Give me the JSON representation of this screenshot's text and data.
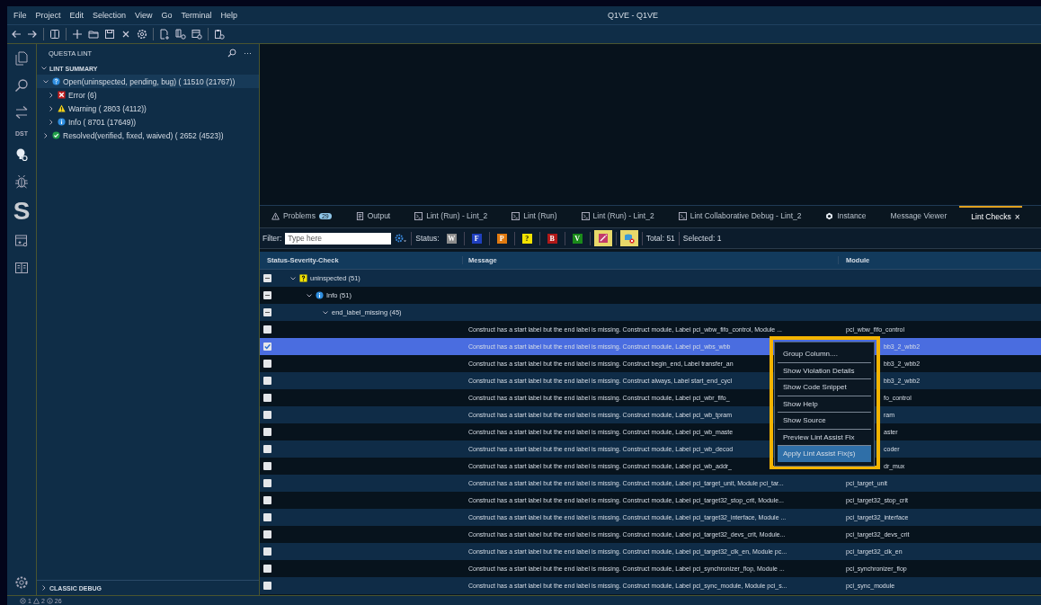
{
  "menu": [
    "File",
    "Project",
    "Edit",
    "Selection",
    "View",
    "Go",
    "Terminal",
    "Help"
  ],
  "window": {
    "title": "Q1VE - Q1VE"
  },
  "activity_bar": {
    "labels": [
      {
        "kind": "dst",
        "text": "DST"
      },
      {
        "kind": "s",
        "text": "S"
      }
    ]
  },
  "sidebar": {
    "title": "QUESTA LINT",
    "more": "···",
    "section": {
      "title": "LINT SUMMARY",
      "expanded": true,
      "items": [
        {
          "label": "Open(uninspected, pending, bug) ( 11510 (21767))",
          "kind": "question",
          "expanded": true,
          "selected": true,
          "children": [
            {
              "label": "Error (6)",
              "kind": "error",
              "expanded": false,
              "selected": false
            },
            {
              "label": "Warning ( 2803 (4112))",
              "kind": "warning",
              "expanded": false,
              "selected": false
            },
            {
              "label": "Info ( 8701 (17649))",
              "kind": "info",
              "expanded": false,
              "selected": false
            }
          ]
        },
        {
          "label": "Resolved(verified, fixed, waived) ( 2652 (4523))",
          "kind": "resolved",
          "expanded": false,
          "selected": false
        }
      ]
    },
    "bottom_section": {
      "title": "CLASSIC DEBUG",
      "expanded": false
    }
  },
  "panel": {
    "tabs": [
      {
        "label": "Problems",
        "kind": "warning",
        "badge": "29",
        "selected": false
      },
      {
        "label": "Output",
        "kind": "output",
        "selected": false
      },
      {
        "label": "Lint (Run) - Lint_2",
        "kind": "terminal",
        "selected": false
      },
      {
        "label": "Lint (Run)",
        "kind": "terminal",
        "selected": false
      },
      {
        "label": "Lint (Run) - Lint_2",
        "kind": "terminal",
        "selected": false
      },
      {
        "label": "Lint Collaborative Debug - Lint_2",
        "kind": "terminal",
        "selected": false
      },
      {
        "label": "Instance",
        "kind": "instance",
        "selected": false
      },
      {
        "label": "Message Viewer",
        "selected": false
      },
      {
        "label": "Lint Checks",
        "selected": true,
        "close": "×"
      }
    ]
  },
  "filter_bar": {
    "label": "Filter:",
    "placeholder": "Type here",
    "status_label": "Status:",
    "status_buttons": [
      {
        "text": "W",
        "color": "#8c8c8c"
      },
      {
        "text": "F",
        "color": "#1f3fbf"
      },
      {
        "text": "P",
        "color": "#e07a10"
      },
      {
        "text": "?",
        "color": "#f2e200"
      },
      {
        "text": "B",
        "color": "#b01818"
      },
      {
        "text": "V",
        "color": "#1a8a1a"
      }
    ],
    "toggles": [
      {
        "kind": "wand",
        "on": true
      },
      {
        "kind": "database-x",
        "on": true
      }
    ],
    "total": "Total: 51",
    "selected_count": "Selected: 1"
  },
  "table": {
    "columns": [
      "Status-Severity-Check",
      "Message",
      "Module"
    ],
    "tree": [
      {
        "label": "uninspected (51)",
        "kind": "unknown",
        "expanded": true,
        "indeterminate": true,
        "children": [
          {
            "label": "Info (51)",
            "kind": "info",
            "expanded": true,
            "indeterminate": true,
            "children": [
              {
                "label": "end_label_missing (45)",
                "expanded": true,
                "indeterminate": true,
                "rows": [
                  {
                    "message": "Construct has a start label but the end label is missing. Construct module, Label pci_wbw_fifo_control, Module ...",
                    "module": "pci_wbw_fifo_control",
                    "checked": false,
                    "selected": false
                  },
                  {
                    "message": "Construct has a start label but the end label is missing. Construct module, Label pci_wbs_wbb",
                    "module": "bb3_2_wbb2",
                    "checked": true,
                    "selected": true,
                    "under_menu": true
                  },
                  {
                    "message": "Construct has a start label but the end label is missing. Construct begin_end, Label transfer_an",
                    "module": "bb3_2_wbb2",
                    "checked": false,
                    "selected": false,
                    "under_menu": true
                  },
                  {
                    "message": "Construct has a start label but the end label is missing. Construct always, Label start_end_cycl",
                    "module": "bb3_2_wbb2",
                    "checked": false,
                    "selected": false,
                    "under_menu": true
                  },
                  {
                    "message": "Construct has a start label but the end label is missing. Construct module, Label pci_wbr_fifo_",
                    "module": "fo_control",
                    "checked": false,
                    "selected": false,
                    "under_menu": true
                  },
                  {
                    "message": "Construct has a start label but the end label is missing. Construct module, Label pci_wb_tpram",
                    "module": "ram",
                    "checked": false,
                    "selected": false,
                    "under_menu": true
                  },
                  {
                    "message": "Construct has a start label but the end label is missing. Construct module, Label pci_wb_maste",
                    "module": "aster",
                    "checked": false,
                    "selected": false,
                    "under_menu": true
                  },
                  {
                    "message": "Construct has a start label but the end label is missing. Construct module, Label pci_wb_decod",
                    "module": "coder",
                    "checked": false,
                    "selected": false,
                    "under_menu": true
                  },
                  {
                    "message": "Construct has a start label but the end label is missing. Construct module, Label pci_wb_addr_",
                    "module": "dr_mux",
                    "checked": false,
                    "selected": false,
                    "under_menu": true
                  },
                  {
                    "message": "Construct has a start label but the end label is missing. Construct module, Label pci_target_unit, Module pci_tar...",
                    "module": "pci_target_unit",
                    "checked": false,
                    "selected": false
                  },
                  {
                    "message": "Construct has a start label but the end label is missing. Construct module, Label pci_target32_stop_crit, Module...",
                    "module": "pci_target32_stop_crit",
                    "checked": false,
                    "selected": false
                  },
                  {
                    "message": "Construct has a start label but the end label is missing. Construct module, Label pci_target32_interface, Module ...",
                    "module": "pci_target32_interface",
                    "checked": false,
                    "selected": false
                  },
                  {
                    "message": "Construct has a start label but the end label is missing. Construct module, Label pci_target32_devs_crit, Module...",
                    "module": "pci_target32_devs_crit",
                    "checked": false,
                    "selected": false
                  },
                  {
                    "message": "Construct has a start label but the end label is missing. Construct module, Label pci_target32_clk_en, Module pc...",
                    "module": "pci_target32_clk_en",
                    "checked": false,
                    "selected": false
                  },
                  {
                    "message": "Construct has a start label but the end label is missing. Construct module, Label pci_synchronizer_flop, Module ...",
                    "module": "pci_synchronizer_flop",
                    "checked": false,
                    "selected": false
                  },
                  {
                    "message": "Construct has a start label but the end label is missing. Construct module, Label pci_sync_module, Module pci_s...",
                    "module": "pci_sync_module",
                    "checked": false,
                    "selected": false
                  }
                ]
              }
            ]
          }
        ]
      }
    ]
  },
  "context_menu": {
    "items": [
      {
        "label": "Group Column....",
        "selected": false
      },
      {
        "label": "Show Violation Details",
        "selected": false
      },
      {
        "label": "Show Code Snippet",
        "selected": false
      },
      {
        "label": "Show Help",
        "selected": false
      },
      {
        "label": "Show Source",
        "selected": false
      },
      {
        "label": "Preview Lint Assist Fix",
        "selected": false
      },
      {
        "label": "Apply Lint Assist Fix(s)",
        "selected": true
      }
    ]
  },
  "status_bar": {
    "errors": "1",
    "warnings": "2",
    "infos": "26"
  }
}
